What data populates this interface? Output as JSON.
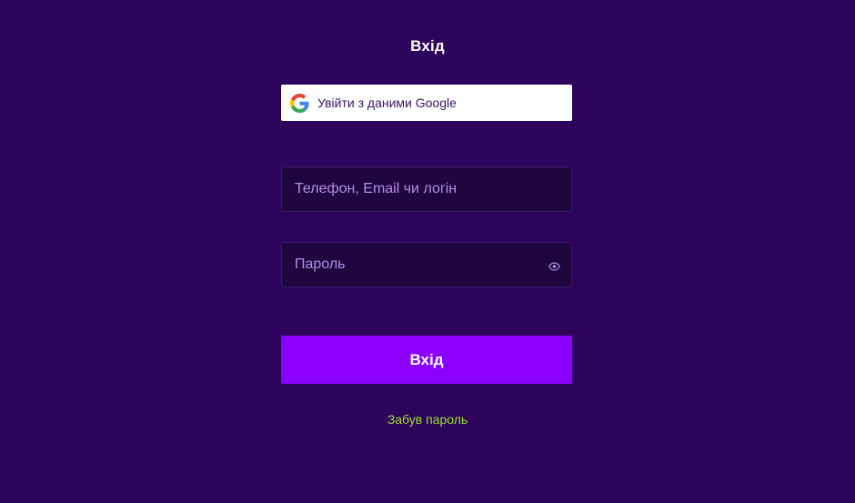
{
  "page": {
    "title": "Вхід"
  },
  "google": {
    "label": "Увійти з даними Google",
    "icon": "google-logo-icon"
  },
  "login_field": {
    "placeholder": "Телефон, Email чи логін",
    "value": ""
  },
  "password_field": {
    "placeholder": "Пароль",
    "value": "",
    "icon": "eye-icon"
  },
  "submit": {
    "label": "Вхід"
  },
  "forgot": {
    "label": "Забув пароль"
  },
  "colors": {
    "background": "#2d035b",
    "field_background": "#1e063f",
    "accent": "#8c00ff",
    "link": "#9be22d"
  }
}
